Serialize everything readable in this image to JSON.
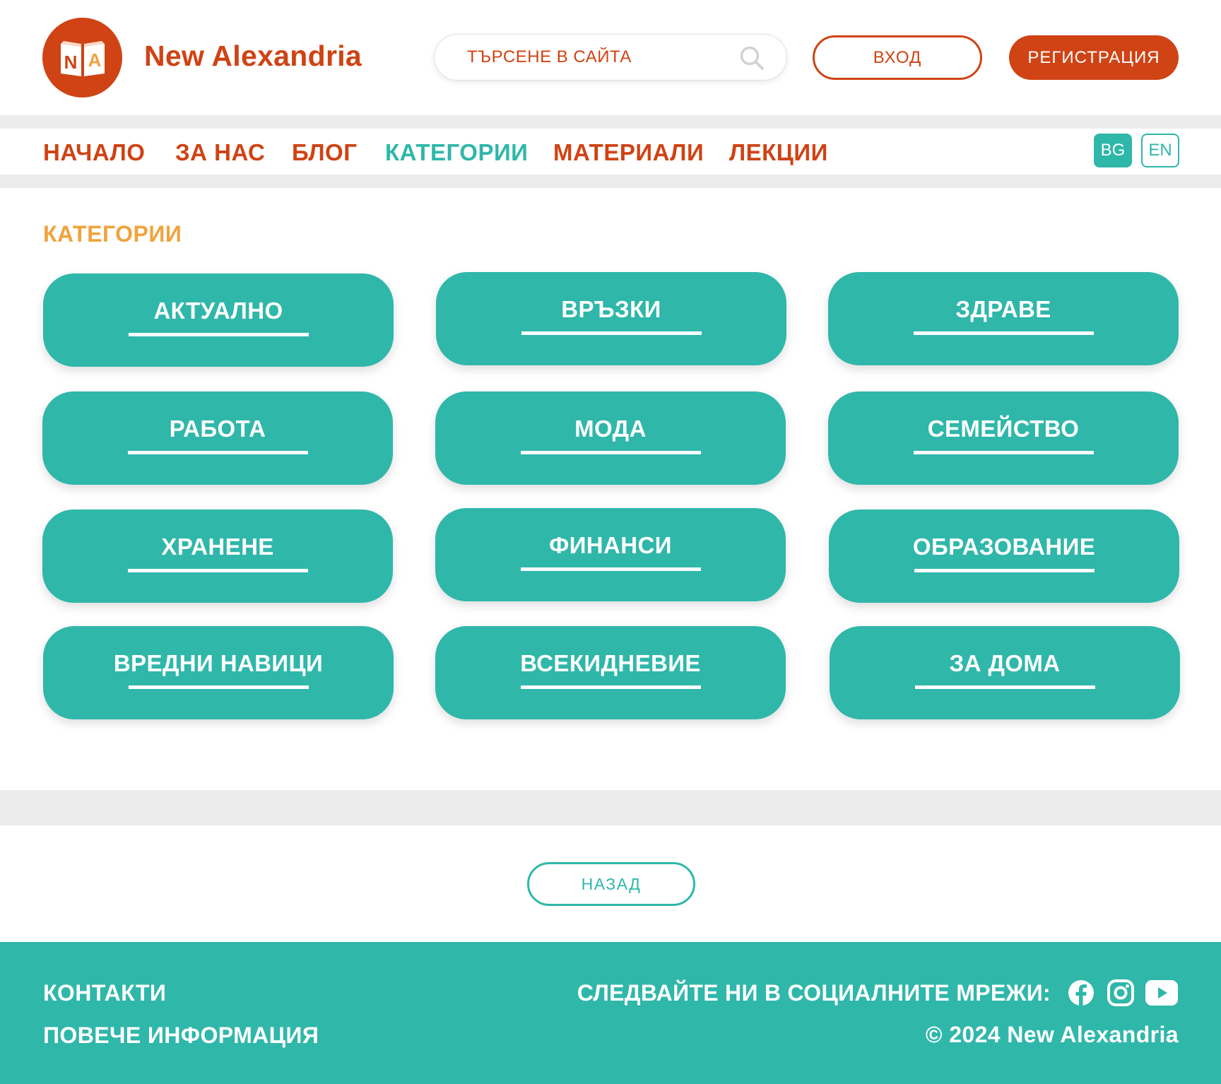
{
  "header": {
    "brand": "New Alexandria",
    "logo_letters": {
      "left": "N",
      "right": "A"
    },
    "search_placeholder": "ТЪРСЕНЕ В САЙТА",
    "login_label": "ВХОД",
    "register_label": "РЕГИСТРАЦИЯ"
  },
  "nav": {
    "items": [
      {
        "label": "НАЧАЛО"
      },
      {
        "label": "ЗА НАС"
      },
      {
        "label": "БЛОГ"
      },
      {
        "label": "КАТЕГОРИИ"
      },
      {
        "label": "МАТЕРИАЛИ"
      },
      {
        "label": "ЛЕКЦИИ"
      }
    ],
    "active_label": "КАТЕГОРИИ",
    "languages": [
      "BG",
      "EN"
    ],
    "active_language": "BG"
  },
  "main": {
    "title": "КАТЕГОРИИ",
    "categories": [
      {
        "label": "АКТУАЛНО"
      },
      {
        "label": "ВРЪЗКИ"
      },
      {
        "label": "ЗДРАВЕ"
      },
      {
        "label": "РАБОТА"
      },
      {
        "label": "МОДА"
      },
      {
        "label": "СЕМЕЙСТВО"
      },
      {
        "label": "ХРАНЕНЕ"
      },
      {
        "label": "ФИНАНСИ"
      },
      {
        "label": "ОБРАЗОВАНИЕ"
      },
      {
        "label": "ВРЕДНИ НАВИЦИ"
      },
      {
        "label": "ВСЕКИДНЕВИЕ"
      },
      {
        "label": "ЗА ДОМА"
      }
    ],
    "back_label": "НАЗАД"
  },
  "footer": {
    "contacts": "КОНТАКТИ",
    "more_info": "ПОВЕЧЕ ИНФОРМАЦИЯ",
    "follow": "СЛЕДВАЙТЕ НИ В СОЦИАЛНИТЕ МРЕЖИ:",
    "social_icons": [
      "facebook-icon",
      "instagram-icon",
      "youtube-icon"
    ],
    "copyright": "©  2024  New Alexandria"
  },
  "colors": {
    "brand_orange": "#cf4314",
    "teal": "#2fb7aa",
    "title_amber": "#f0a33c",
    "separator_grey": "#ececec"
  }
}
